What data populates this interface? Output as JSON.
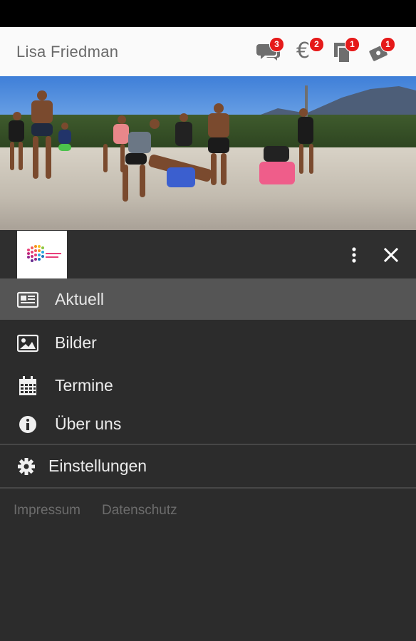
{
  "header": {
    "user_name": "Lisa Friedman",
    "icons": [
      {
        "name": "chat-icon",
        "badge": "3"
      },
      {
        "name": "euro-icon",
        "badge": "2"
      },
      {
        "name": "documents-icon",
        "badge": "1"
      },
      {
        "name": "tickets-icon",
        "badge": "1"
      }
    ],
    "euro_glyph": "€"
  },
  "hero": {
    "subject": "beach-sports-photo"
  },
  "drawer": {
    "logo_icon": "org-logo-icon",
    "more_icon": "more-vert-icon",
    "close_icon": "close-icon",
    "items": [
      {
        "label": "Aktuell",
        "icon": "news-icon",
        "active": true
      },
      {
        "label": "Bilder",
        "icon": "image-icon",
        "active": false
      },
      {
        "label": "Termine",
        "icon": "calendar-icon",
        "active": false
      },
      {
        "label": "Über uns",
        "icon": "info-icon",
        "active": false
      }
    ],
    "settings": {
      "label": "Einstellungen",
      "icon": "gear-icon"
    },
    "footer": {
      "impressum": "Impressum",
      "datenschutz": "Datenschutz"
    }
  },
  "colors": {
    "badge": "#e51a1a",
    "drawer_bg": "#2c2c2c",
    "active_item": "#555555",
    "topbar": "#fafafa"
  }
}
